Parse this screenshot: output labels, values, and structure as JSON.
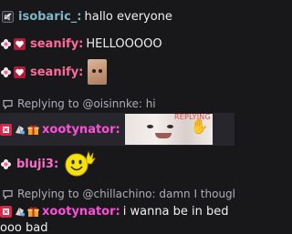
{
  "messages": [
    {
      "id": "m1",
      "username": "isobaric_",
      "user_color": "#7fb6c4",
      "text": "hallo everyone",
      "badges": [
        "no-audio-icon"
      ]
    },
    {
      "id": "m2",
      "username": "seanify",
      "user_color": "#ff6b97",
      "text": "HELLOOOOO",
      "badges": [
        "flower-icon",
        "heart-badge-icon"
      ]
    },
    {
      "id": "m3",
      "username": "seanify",
      "user_color": "#ff6b97",
      "text": "",
      "badges": [
        "flower-icon",
        "heart-badge-icon"
      ],
      "emote": "cat-emote"
    },
    {
      "id": "m4",
      "reply_prefix": "Replying to @oisinnke: hi",
      "username": "xootynator",
      "user_color": "#ff4fd8",
      "text": "",
      "badges": [
        "sub-badge-icon",
        "bits-badge-icon",
        "gift-badge-icon"
      ],
      "emote": "baby-emote",
      "emote_overlay_text": "REPLYING T"
    },
    {
      "id": "m5",
      "username": "bluji3",
      "user_color": "#ff6bc8",
      "text": "",
      "badges": [
        "flower-icon"
      ],
      "emote": "smiley-wave-emote"
    },
    {
      "id": "m6",
      "reply_prefix": "Replying to @chillachino: damn I thought you",
      "username": "xootynator",
      "user_color": "#ff4fd8",
      "text": "i wanna be in bed",
      "badges": [
        "sub-badge-icon",
        "bits-badge-icon",
        "gift-badge-icon"
      ]
    },
    {
      "id": "m7",
      "text": "ooo bad"
    }
  ]
}
